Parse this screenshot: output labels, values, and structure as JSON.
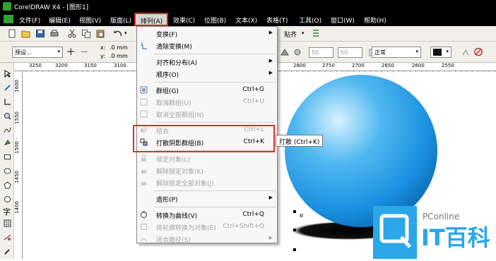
{
  "window": {
    "title": "CorelDRAW X4 - [图形1]"
  },
  "menubar": {
    "items": [
      {
        "id": "file",
        "label": "文件(F)"
      },
      {
        "id": "edit",
        "label": "编辑(E)"
      },
      {
        "id": "view",
        "label": "视图(V)"
      },
      {
        "id": "layout",
        "label": "版面(L)"
      },
      {
        "id": "arrange",
        "label": "排列(A)"
      },
      {
        "id": "effects",
        "label": "效果(C)"
      },
      {
        "id": "bitmaps",
        "label": "位图(B)"
      },
      {
        "id": "text",
        "label": "文本(X)"
      },
      {
        "id": "table",
        "label": "表格(T)"
      },
      {
        "id": "tools",
        "label": "工具(O)"
      },
      {
        "id": "window",
        "label": "窗口(W)"
      },
      {
        "id": "help",
        "label": "帮助(H)"
      }
    ]
  },
  "toolbar": {
    "snap_label": "贴齐"
  },
  "propbar": {
    "preset": "预设...",
    "x_label": "x:",
    "x_value": ".0 mm",
    "y_label": "y:",
    "y_value": ".0 mm",
    "spin1": "50",
    "spin2": "50",
    "mode": "正常"
  },
  "ruler": {
    "top": [
      "3250",
      "3200",
      "3150",
      "3100",
      "2800",
      "2750",
      "2700",
      "2650",
      "2600",
      "2550"
    ],
    "left": [
      "1600",
      "1550",
      "1500",
      "1450",
      "1400"
    ]
  },
  "toolbox": {
    "text_tool": "字"
  },
  "menu": {
    "items": [
      {
        "label": "变换(F)",
        "shortcut": "",
        "submenu": true,
        "disabled": false,
        "icon": ""
      },
      {
        "label": "清除变换(M)",
        "shortcut": "",
        "submenu": false,
        "disabled": false,
        "icon": "clear-transform-icon"
      },
      {
        "label": "对齐和分布(A)",
        "shortcut": "",
        "submenu": true,
        "disabled": false,
        "icon": ""
      },
      {
        "label": "顺序(O)",
        "shortcut": "",
        "submenu": true,
        "disabled": false,
        "icon": ""
      },
      {
        "label": "群组(G)",
        "shortcut": "Ctrl+G",
        "submenu": false,
        "disabled": false,
        "icon": "group-icon"
      },
      {
        "label": "取消群组(U)",
        "shortcut": "Ctrl+U",
        "submenu": false,
        "disabled": true,
        "icon": "ungroup-icon"
      },
      {
        "label": "取消全部群组(N)",
        "shortcut": "",
        "submenu": false,
        "disabled": true,
        "icon": "ungroup-all-icon"
      },
      {
        "label": "结合",
        "shortcut": "Ctrl+L",
        "submenu": false,
        "disabled": true,
        "icon": "combine-icon"
      },
      {
        "label": "打散阴影群组(B)",
        "shortcut": "Ctrl+K",
        "submenu": false,
        "disabled": false,
        "icon": "break-apart-icon"
      },
      {
        "label": "锁定对象(L)",
        "shortcut": "",
        "submenu": false,
        "disabled": true,
        "icon": "lock-icon"
      },
      {
        "label": "解除锁定对象(K)",
        "shortcut": "",
        "submenu": false,
        "disabled": true,
        "icon": "unlock-icon"
      },
      {
        "label": "解除锁定全部对象(J)",
        "shortcut": "",
        "submenu": false,
        "disabled": true,
        "icon": "unlock-all-icon"
      },
      {
        "label": "造形(P)",
        "shortcut": "",
        "submenu": true,
        "disabled": false,
        "icon": ""
      },
      {
        "label": "转换为曲线(V)",
        "shortcut": "Ctrl+Q",
        "submenu": false,
        "disabled": false,
        "icon": "convert-curves-icon"
      },
      {
        "label": "将轮廓转换为对象(E)",
        "shortcut": "Ctrl+Shift+Q",
        "submenu": false,
        "disabled": true,
        "icon": "outline-object-icon"
      },
      {
        "label": "闭合路径(S)",
        "shortcut": "",
        "submenu": true,
        "disabled": true,
        "icon": "close-path-icon"
      }
    ]
  },
  "tooltip": "打散 (Ctrl+K)",
  "watermark": {
    "brand": "PConline",
    "name": "IT百科"
  },
  "colors": {
    "highlight": "#e02020",
    "sphere": "#1a8fe0",
    "menubar": "#000000"
  }
}
